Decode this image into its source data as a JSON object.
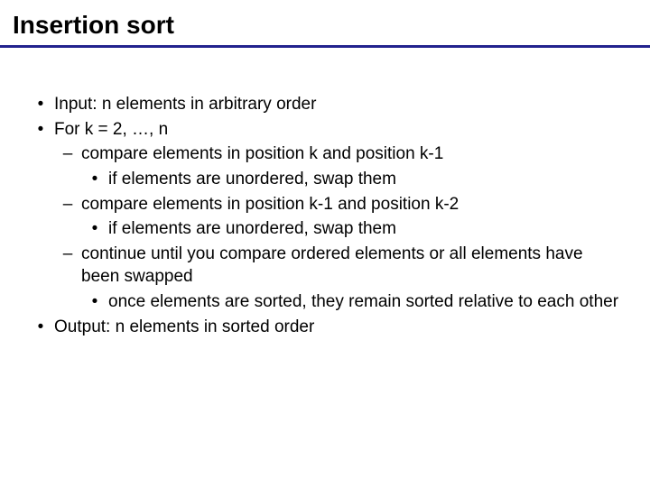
{
  "title": "Insertion sort",
  "bullets": {
    "input": "Input: n elements in arbitrary order",
    "for": "For k = 2, …, n",
    "compare1": "compare elements in position k and position k-1",
    "if1": "if elements are unordered, swap them",
    "compare2": "compare elements in position k-1 and position k-2",
    "if2": "if elements are unordered, swap them",
    "continue": "continue until you compare ordered elements or all elements have been swapped",
    "once": "once elements are sorted, they remain sorted relative to each other",
    "output": "Output: n elements in sorted order"
  },
  "glyphs": {
    "dot": "•",
    "dash": "–"
  }
}
